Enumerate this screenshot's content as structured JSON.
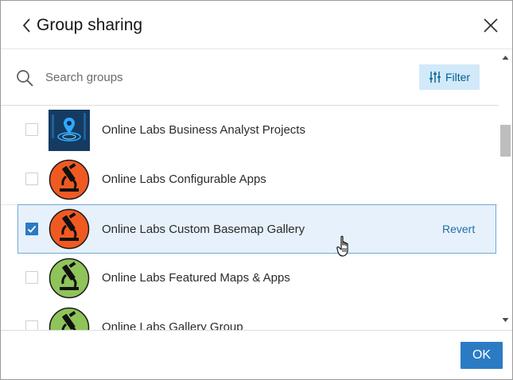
{
  "dialog": {
    "title": "Group sharing",
    "back_icon": "chevron-left-icon",
    "close_icon": "close-icon"
  },
  "search": {
    "placeholder": "Search groups",
    "value": "",
    "icon": "search-icon",
    "filter_label": "Filter",
    "filter_icon": "sliders-icon"
  },
  "groups": [
    {
      "label": "Online Labs Business Analyst Projects",
      "checked": false,
      "thumbnail": "business-analyst-thumbnail"
    },
    {
      "label": "Online Labs Configurable Apps",
      "checked": false,
      "thumbnail": "microscope-orange-icon"
    },
    {
      "label": "Online Labs Custom Basemap Gallery",
      "checked": true,
      "thumbnail": "microscope-orange-icon",
      "action_label": "Revert"
    },
    {
      "label": "Online Labs Featured Maps & Apps",
      "checked": false,
      "thumbnail": "microscope-green-icon"
    },
    {
      "label": "Online Labs Gallery Group",
      "checked": false,
      "thumbnail": "microscope-green-icon"
    }
  ],
  "footer": {
    "ok_label": "OK"
  },
  "colors": {
    "accent": "#2b7bc4",
    "filter_bg": "#d2e9f9",
    "selected_row_bg": "#e7f1fb",
    "orange_thumb": "#f05a22",
    "green_thumb": "#8fc45a",
    "dark_blue_thumb": "#0f2a4a"
  }
}
